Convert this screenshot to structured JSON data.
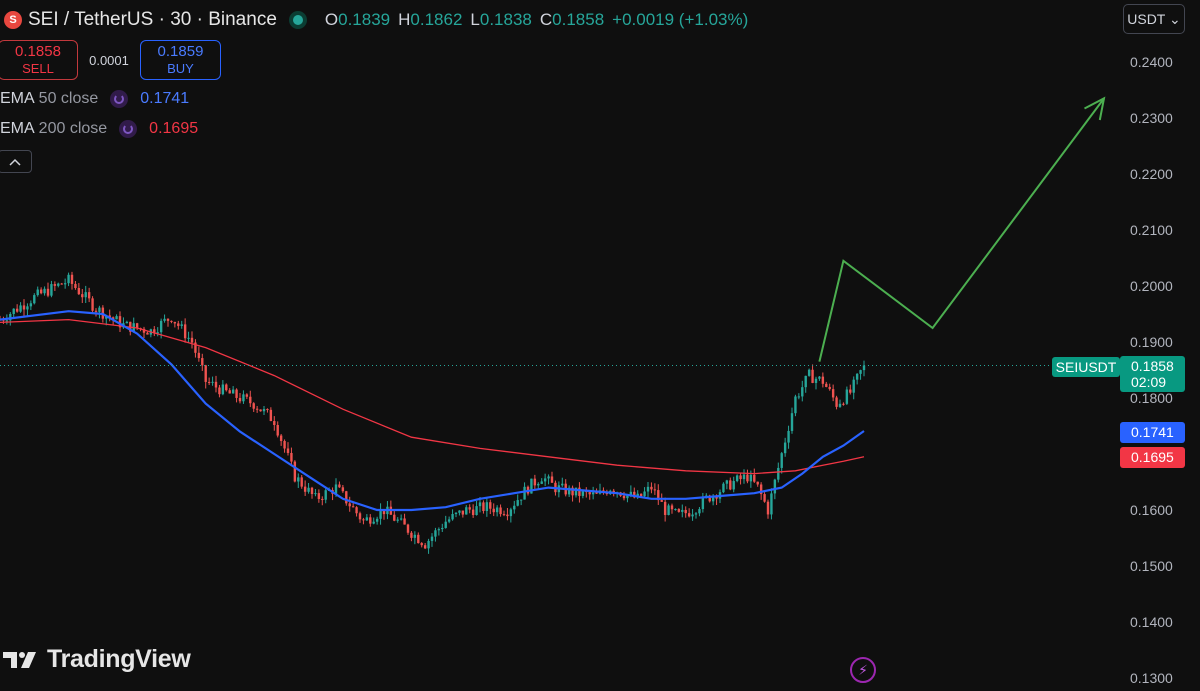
{
  "header": {
    "symbol": "SEI / TetherUS · 30 · Binance",
    "logo_letter": "S",
    "ohlc": [
      {
        "k": "O",
        "v": "0.1839"
      },
      {
        "k": "H",
        "v": "0.1862"
      },
      {
        "k": "L",
        "v": "0.1838"
      },
      {
        "k": "C",
        "v": "0.1858"
      }
    ],
    "change": "+0.0019 (+1.03%)"
  },
  "trade": {
    "sell_price": "0.1858",
    "sell_label": "SELL",
    "spread": "0.0001",
    "buy_price": "0.1859",
    "buy_label": "BUY"
  },
  "indicators": [
    {
      "name": "EMA",
      "params": "50 close",
      "value": "0.1741",
      "color": "#2962ff"
    },
    {
      "name": "EMA",
      "params": "200 close",
      "value": "0.1695",
      "color": "#f23645"
    }
  ],
  "currency_button": "USDT ⌄",
  "collapse_icon": "chevron-up-icon",
  "brand": "TradingView",
  "price_labels": {
    "symbol": "SEIUSDT",
    "last_price": "0.1858",
    "countdown": "02:09",
    "ema50": "0.1741",
    "ema200": "0.1695"
  },
  "colors": {
    "up": "#26a69a",
    "down": "#ef5350",
    "ema50": "#2962ff",
    "ema200": "#f23645",
    "projection": "#4caf50",
    "background": "#0f0f0f"
  },
  "chart_data": {
    "type": "candlestick",
    "ylim": [
      0.13,
      0.245
    ],
    "y_ticks": [
      "0.2400",
      "0.2300",
      "0.2200",
      "0.2100",
      "0.2000",
      "0.1900",
      "0.1800",
      "0.1600",
      "0.1500",
      "0.1400",
      "0.1300"
    ],
    "last_price": 0.1858,
    "ema50_last": 0.1741,
    "ema200_last": 0.1695,
    "close_path": [
      [
        0,
        0.194
      ],
      [
        10,
        0.198
      ],
      [
        20,
        0.201
      ],
      [
        28,
        0.196
      ],
      [
        36,
        0.193
      ],
      [
        44,
        0.192
      ],
      [
        50,
        0.1945
      ],
      [
        56,
        0.19
      ],
      [
        60,
        0.183
      ],
      [
        66,
        0.181
      ],
      [
        74,
        0.179
      ],
      [
        80,
        0.176
      ],
      [
        86,
        0.166
      ],
      [
        92,
        0.162
      ],
      [
        98,
        0.164
      ],
      [
        106,
        0.158
      ],
      [
        112,
        0.16
      ],
      [
        118,
        0.157
      ],
      [
        124,
        0.154
      ],
      [
        130,
        0.158
      ],
      [
        136,
        0.16
      ],
      [
        142,
        0.1605
      ],
      [
        148,
        0.16
      ],
      [
        154,
        0.164
      ],
      [
        158,
        0.166
      ],
      [
        162,
        0.164
      ],
      [
        168,
        0.163
      ],
      [
        174,
        0.1625
      ],
      [
        178,
        0.164
      ],
      [
        182,
        0.163
      ],
      [
        186,
        0.162
      ],
      [
        190,
        0.164
      ],
      [
        194,
        0.16
      ],
      [
        198,
        0.159
      ],
      [
        202,
        0.16
      ],
      [
        206,
        0.162
      ],
      [
        210,
        0.1635
      ],
      [
        214,
        0.165
      ],
      [
        218,
        0.166
      ],
      [
        221,
        0.164
      ],
      [
        224,
        0.16
      ],
      [
        228,
        0.17
      ],
      [
        232,
        0.18
      ],
      [
        236,
        0.184
      ],
      [
        240,
        0.183
      ],
      [
        244,
        0.179
      ],
      [
        248,
        0.181
      ],
      [
        252,
        0.1858
      ]
    ],
    "ema50": [
      [
        0,
        0.194
      ],
      [
        20,
        0.1955
      ],
      [
        30,
        0.195
      ],
      [
        40,
        0.1915
      ],
      [
        50,
        0.186
      ],
      [
        60,
        0.179
      ],
      [
        70,
        0.174
      ],
      [
        80,
        0.17
      ],
      [
        90,
        0.166
      ],
      [
        100,
        0.162
      ],
      [
        110,
        0.16
      ],
      [
        120,
        0.16
      ],
      [
        130,
        0.1605
      ],
      [
        140,
        0.162
      ],
      [
        150,
        0.163
      ],
      [
        160,
        0.164
      ],
      [
        170,
        0.1635
      ],
      [
        180,
        0.163
      ],
      [
        190,
        0.162
      ],
      [
        200,
        0.162
      ],
      [
        210,
        0.1625
      ],
      [
        220,
        0.163
      ],
      [
        228,
        0.164
      ],
      [
        234,
        0.1665
      ],
      [
        240,
        0.1695
      ],
      [
        246,
        0.1715
      ],
      [
        252,
        0.1741
      ]
    ],
    "ema200": [
      [
        0,
        0.1935
      ],
      [
        20,
        0.194
      ],
      [
        40,
        0.1925
      ],
      [
        60,
        0.189
      ],
      [
        80,
        0.184
      ],
      [
        100,
        0.178
      ],
      [
        120,
        0.173
      ],
      [
        140,
        0.171
      ],
      [
        160,
        0.1695
      ],
      [
        180,
        0.168
      ],
      [
        200,
        0.167
      ],
      [
        220,
        0.1665
      ],
      [
        232,
        0.167
      ],
      [
        240,
        0.168
      ],
      [
        246,
        0.1687
      ],
      [
        252,
        0.1695
      ]
    ],
    "projection": [
      [
        239,
        0.1865
      ],
      [
        246,
        0.2045
      ],
      [
        272,
        0.1925
      ],
      [
        322,
        0.2335
      ]
    ],
    "x_range": [
      0,
      330
    ]
  }
}
